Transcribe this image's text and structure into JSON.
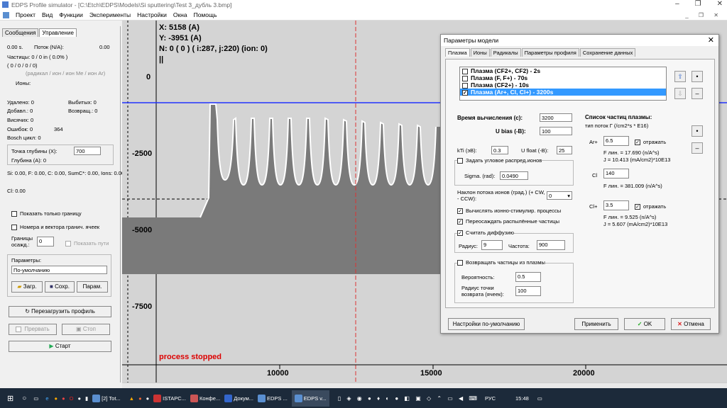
{
  "window": {
    "title": "EDPS Profile simulator - [C:\\Etch\\EDPS\\Models\\Si sputtering\\Test 3_дубль 3.bmp]",
    "controls": [
      "–",
      "❐",
      "✕"
    ]
  },
  "menu": {
    "items": [
      "Проект",
      "Вид",
      "Функции",
      "Эксперименты",
      "Настройки",
      "Окна",
      "Помощь"
    ],
    "right": "_ ❐ ✕"
  },
  "left": {
    "tabs": [
      "Сообщения",
      "Управление"
    ],
    "time": "0.00 s.",
    "flux": "Поток (N/A):",
    "flux_val": "0.00",
    "particles": "Частицы: 0 / 0 in ( 0.0% )",
    "zeros": "( 0 / 0 / 0 / 0)",
    "legend": "(радикал / ион / ион Me / ион Ar)",
    "ions": "Ионы:",
    "deleted": "Удалено: 0",
    "knocked": "Выбитых:  0",
    "added": "Добавл.: 0",
    "returned": "Возвращ.: 0",
    "hanging": "Висячих:  0",
    "errors": "Ошибок:  0",
    "errors_val": "364",
    "bosch": "Bosch цикл:   0",
    "depth_point": "Точка глубины (X):",
    "depth_point_val": "700",
    "depth": "Глубина (A): 0",
    "si": "Si: 0.00, F: 0.00, C: 0.00, SumC*: 0.00, Ions: 0.00",
    "cl": "Cl: 0.00",
    "show_border": "Показать только границу",
    "show_numbers": "Номера и вектора гранич. ячеек",
    "border_label": "Границы осажд.:",
    "border_val": "0",
    "show_paths": "Показать пути",
    "params_label": "Параметры:",
    "params_val": "По-умолчанию",
    "load": "Загр.",
    "save": "Сохр.",
    "params_btn": "Парам.",
    "reload": "Перезагрузить профиль",
    "interrupt": "Прервать",
    "stop": "Стоп",
    "start": "Старт"
  },
  "plot": {
    "x": "X: 5158 (A)",
    "y": "Y: -3951 (A)",
    "n": "N: 0 ( 0 )  ( i:287, j:220) (ion: 0)",
    "pause": "||",
    "yticks": [
      "0",
      "-2500",
      "-5000",
      "-7500"
    ],
    "xticks": [
      "10000",
      "15000",
      "20000"
    ],
    "status": "process stopped"
  },
  "dialog": {
    "title": "Параметры модели",
    "close": "✕",
    "tabs": [
      "Плазма",
      "Ионы",
      "Радикалы",
      "Параметры профиля",
      "Сохранение данных"
    ],
    "plasmas": [
      "Плазма (CF2+, CF2) - 2s",
      "Плазма (F, F+) - 70s",
      "Плазма (CF2+) - 10s",
      "Плазма (Ar+, Cl, Cl+) - 3200s"
    ],
    "calc_time": "Время вычисления (c):",
    "calc_time_val": "3200",
    "ubias": "U bias (-В):",
    "ubias_val": "100",
    "kti": "kTi  (эВ):",
    "kti_val": "0.3",
    "ufloat": "U float (-В):",
    "ufloat_val": "25",
    "angular": "Задать угловое распред.ионов",
    "sigma": "Sigma. (rad):",
    "sigma_val": "0.0490",
    "slope": "Наклон потока ионов (град.) (+ CW, - CCW):",
    "slope_val": "0",
    "ion_stim": "Вычислять ионно-стимулир. процессы",
    "resputter": "Переосаждать распылённые частицы",
    "diffusion": "Считать диффузию",
    "radius": "Радиус:",
    "radius_val": "9",
    "freq": "Частота:",
    "freq_val": "900",
    "return": "Возвращать частицы из плазмы",
    "prob": "Вероятность:",
    "prob_val": "0.5",
    "ret_point": "Радиус точки возврата (ячеек):",
    "ret_point_val": "100",
    "list_title": "Список частиц плазмы:",
    "list_header": "тип   поток Г (/cm2*s  * E16)",
    "ar": "Ar+",
    "ar_val": "6.5",
    "reflect": "отражать",
    "ar_f": "F лин. = 17.690 (n/A^s)",
    "ar_j": "J = 10.413 (mA/cm2)*10E13",
    "cl": "Cl",
    "cl_val": "140",
    "cl_f": "F лин. = 381.009 (n/A^s)",
    "clp": "Cl+",
    "clp_val": "3.5",
    "clp_f": "F лин. = 9.525 (n/A^s)",
    "clp_j": "J = 5.607 (mA/cm2)*10E13",
    "defaults": "Настройки по-умолчанию",
    "apply": "Применить",
    "ok": "OK",
    "cancel": "Отмена"
  },
  "taskbar": {
    "items": [
      "[2] Tot...",
      "ISTAPC...",
      "Конфе...",
      "Докум...",
      "EDPS ...",
      "EDPS v..."
    ],
    "lang": "РУС",
    "time": "15:48"
  }
}
